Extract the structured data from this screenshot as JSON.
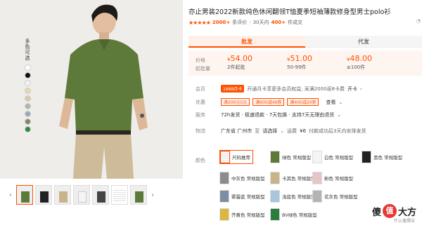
{
  "product": {
    "title": "亦止男装2022新款纯色休闲翻领T恤夏季短袖薄款修身型男士polo衫",
    "rating_stars": "★★★★★",
    "reviews_count": "2000+",
    "reviews_label": "条评价",
    "sales_prefix": "30天内",
    "sales_count": "400+",
    "sales_suffix": "件成交"
  },
  "tabs": [
    {
      "label": "批发",
      "active": true
    },
    {
      "label": "代发",
      "active": false
    }
  ],
  "price": {
    "price_label": "价格",
    "moq_label": "起批量",
    "tiers": [
      {
        "currency": "¥",
        "value": "54.00",
        "qty": "2件起批"
      },
      {
        "currency": "¥",
        "value": "51.00",
        "qty": "50-99件"
      },
      {
        "currency": "¥",
        "value": "48.00",
        "qty": "≥100件"
      }
    ]
  },
  "member": {
    "label": "会员",
    "badge": "1688月卡",
    "text": "开通月卡享更多会员权益, 采满2000返8卡费",
    "action": "开卡"
  },
  "offers": {
    "label": "优惠",
    "coupons": [
      "满200元5元",
      "满600减49券",
      "满400减20券"
    ],
    "action": "查看"
  },
  "service": {
    "label": "服务",
    "text": "72h发货 · 极速退款 · 7天包换 · 支持7天无理由退货"
  },
  "logistics": {
    "label": "物流",
    "origin": "广东省 广州市",
    "to": "至",
    "dest": "请选择",
    "fee_prefix": "运费",
    "fee": "¥6",
    "note": "付款成功后3天内安排发货"
  },
  "colors": {
    "label": "颜色",
    "options": [
      {
        "label": "尺码推荐",
        "color": "#f7f7f7",
        "active": true
      },
      {
        "label": "绿色 常规版型",
        "color": "#5d7a3a"
      },
      {
        "label": "白色 常规版型",
        "color": "#f4f4f4"
      },
      {
        "label": "黑色 常规版型",
        "color": "#222222"
      },
      {
        "label": "中灰色 常规版型",
        "color": "#8c8c8c"
      },
      {
        "label": "卡其色 常规版型",
        "color": "#c9b48a"
      },
      {
        "label": "粉色 常规版型",
        "color": "#e7c4c7"
      },
      {
        "label": "雾霾蓝 常规版型",
        "color": "#7c8ea3"
      },
      {
        "label": "浅蓝色 常规版型",
        "color": "#a9c6dd"
      },
      {
        "label": "花灰色 常规版型",
        "color": "#b4b4b4"
      },
      {
        "label": "芥黄色 常规版型",
        "color": "#d9b740"
      },
      {
        "label": "BV绿色 常规版型",
        "color": "#2c7c3c"
      }
    ]
  },
  "gallery": {
    "color_strip_title": "多色可选",
    "swatches": [
      "#ffffff",
      "#111111",
      "#f3f3f3",
      "#e8d9a6",
      "#d9c9a8",
      "#b3b3b3",
      "#9aa8b8",
      "#7d8a5c",
      "#2f8a3c"
    ],
    "thumbs": [
      "#5d7a3a",
      "#222222",
      "#c9b48a",
      "#f4f4f4",
      "#444444",
      "#ffffff",
      "#5d7a3a"
    ],
    "prev": "‹",
    "next": "›"
  },
  "watermark": {
    "badge": "值",
    "text": "大方",
    "prefix": "傻",
    "sub": "什么值得买"
  }
}
